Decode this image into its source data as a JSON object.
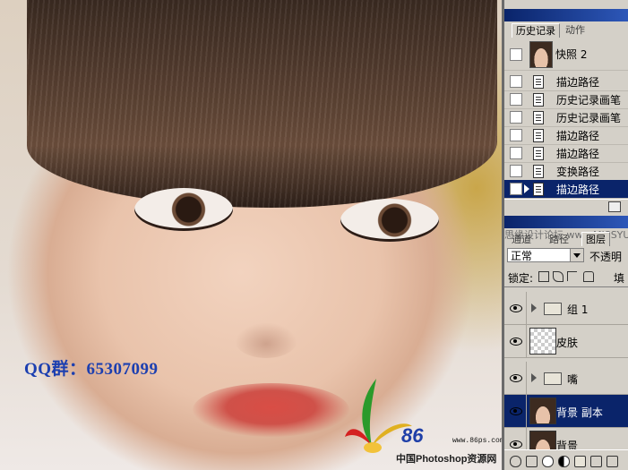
{
  "canvas": {
    "qq_text": "QQ群：65307099",
    "watermark": {
      "logo_number": "86",
      "logo_url": "www.86ps.com",
      "site_name": "中国Photoshop资源网"
    }
  },
  "history_panel": {
    "tabs": [
      {
        "label": "历史记录",
        "active": true
      },
      {
        "label": "动作",
        "active": false
      }
    ],
    "snapshot": {
      "label": "快照 2"
    },
    "items": [
      {
        "label": "描边路径",
        "selected": false
      },
      {
        "label": "历史记录画笔",
        "selected": false
      },
      {
        "label": "历史记录画笔",
        "selected": false
      },
      {
        "label": "描边路径",
        "selected": false
      },
      {
        "label": "描边路径",
        "selected": false
      },
      {
        "label": "变换路径",
        "selected": false
      },
      {
        "label": "描边路径",
        "selected": true
      }
    ]
  },
  "layers_panel": {
    "watermark": "思缘设计论坛 www.MISSYUAN.COM",
    "tabs": [
      "通道",
      "路径",
      "图层"
    ],
    "blend_mode": "正常",
    "opacity_label": "不透明",
    "lock_label": "锁定:",
    "fill_label": "填",
    "layers": [
      {
        "name": "组 1",
        "kind": "group",
        "selected": false
      },
      {
        "name": "皮肤",
        "kind": "transparent",
        "selected": false
      },
      {
        "name": "嘴",
        "kind": "group",
        "selected": false
      },
      {
        "name": "背景 副本",
        "kind": "photo",
        "selected": true
      },
      {
        "name": "背景",
        "kind": "photo",
        "selected": false
      }
    ]
  },
  "colors": {
    "selection": "#0a246a",
    "panel_bg": "#d4d0c8",
    "qq_text": "#1c3fb0"
  }
}
